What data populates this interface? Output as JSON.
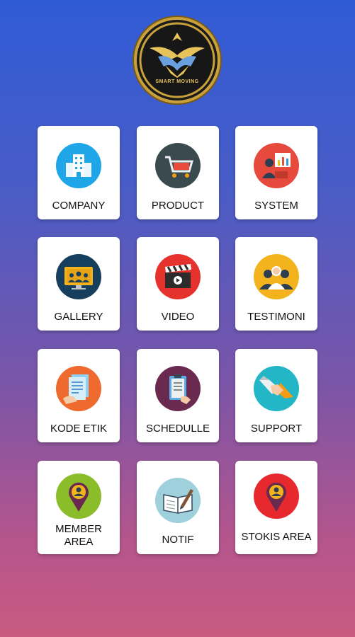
{
  "logo": {
    "brand_text": "SMART MOVING"
  },
  "menu": [
    {
      "label": "COMPANY",
      "icon": "building-icon",
      "color": "#1ea6e8"
    },
    {
      "label": "PRODUCT",
      "icon": "shopping-cart-icon",
      "color": "#3b4a4f"
    },
    {
      "label": "SYSTEM",
      "icon": "presentation-icon",
      "color": "#e64a3c"
    },
    {
      "label": "GALLERY",
      "icon": "video-conference-icon",
      "color": "#163f5e"
    },
    {
      "label": "VIDEO",
      "icon": "clapperboard-icon",
      "color": "#e5322d"
    },
    {
      "label": "TESTIMONI",
      "icon": "people-icon",
      "color": "#f2b31c"
    },
    {
      "label": "KODE ETIK",
      "icon": "document-icon",
      "color": "#ee6a2f"
    },
    {
      "label": "SCHEDULLE",
      "icon": "clipboard-icon",
      "color": "#6a2a4f"
    },
    {
      "label": "SUPPORT",
      "icon": "handshake-icon",
      "color": "#22b6c6"
    },
    {
      "label": "MEMBER AREA",
      "icon": "member-pin-icon",
      "color": "#8bbd2a"
    },
    {
      "label": "NOTIF",
      "icon": "notebook-pen-icon",
      "color": "#9fd1dc"
    },
    {
      "label": "STOKIS AREA",
      "icon": "stokis-pin-icon",
      "color": "#e7282c"
    }
  ]
}
